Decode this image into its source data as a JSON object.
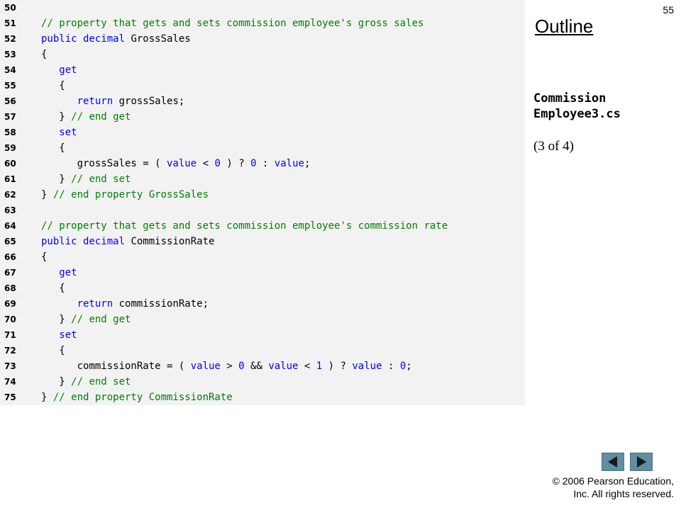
{
  "slide_number": "55",
  "outline": {
    "title": "Outline",
    "filename_line1": "Commission",
    "filename_line2": "Employee3.cs",
    "part": "(3 of 4)"
  },
  "code_lines": [
    {
      "n": "50",
      "tokens": []
    },
    {
      "n": "51",
      "tokens": [
        {
          "t": "cm",
          "s": "// property that gets and sets commission employee's gross sales"
        }
      ]
    },
    {
      "n": "52",
      "tokens": [
        {
          "t": "kw",
          "s": "public decimal"
        },
        {
          "t": "pl",
          "s": " GrossSales"
        }
      ]
    },
    {
      "n": "53",
      "tokens": [
        {
          "t": "pl",
          "s": "{"
        }
      ]
    },
    {
      "n": "54",
      "tokens": [
        {
          "t": "pl",
          "s": "   "
        },
        {
          "t": "kw",
          "s": "get"
        }
      ]
    },
    {
      "n": "55",
      "tokens": [
        {
          "t": "pl",
          "s": "   {"
        }
      ]
    },
    {
      "n": "56",
      "tokens": [
        {
          "t": "pl",
          "s": "      "
        },
        {
          "t": "kw",
          "s": "return"
        },
        {
          "t": "pl",
          "s": " grossSales;"
        }
      ]
    },
    {
      "n": "57",
      "tokens": [
        {
          "t": "pl",
          "s": "   } "
        },
        {
          "t": "cm",
          "s": "// end get"
        }
      ]
    },
    {
      "n": "58",
      "tokens": [
        {
          "t": "pl",
          "s": "   "
        },
        {
          "t": "kw",
          "s": "set"
        }
      ]
    },
    {
      "n": "59",
      "tokens": [
        {
          "t": "pl",
          "s": "   {"
        }
      ]
    },
    {
      "n": "60",
      "tokens": [
        {
          "t": "pl",
          "s": "      grossSales = ( "
        },
        {
          "t": "kw",
          "s": "value"
        },
        {
          "t": "pl",
          "s": " < "
        },
        {
          "t": "kw",
          "s": "0"
        },
        {
          "t": "pl",
          "s": " ) ? "
        },
        {
          "t": "kw",
          "s": "0"
        },
        {
          "t": "pl",
          "s": " : "
        },
        {
          "t": "kw",
          "s": "value"
        },
        {
          "t": "pl",
          "s": ";"
        }
      ]
    },
    {
      "n": "61",
      "tokens": [
        {
          "t": "pl",
          "s": "   } "
        },
        {
          "t": "cm",
          "s": "// end set"
        }
      ]
    },
    {
      "n": "62",
      "tokens": [
        {
          "t": "pl",
          "s": "} "
        },
        {
          "t": "cm",
          "s": "// end property GrossSales"
        }
      ]
    },
    {
      "n": "63",
      "tokens": []
    },
    {
      "n": "64",
      "tokens": [
        {
          "t": "cm",
          "s": "// property that gets and sets commission employee's commission rate"
        }
      ]
    },
    {
      "n": "65",
      "tokens": [
        {
          "t": "kw",
          "s": "public decimal"
        },
        {
          "t": "pl",
          "s": " CommissionRate"
        }
      ]
    },
    {
      "n": "66",
      "tokens": [
        {
          "t": "pl",
          "s": "{"
        }
      ]
    },
    {
      "n": "67",
      "tokens": [
        {
          "t": "pl",
          "s": "   "
        },
        {
          "t": "kw",
          "s": "get"
        }
      ]
    },
    {
      "n": "68",
      "tokens": [
        {
          "t": "pl",
          "s": "   {"
        }
      ]
    },
    {
      "n": "69",
      "tokens": [
        {
          "t": "pl",
          "s": "      "
        },
        {
          "t": "kw",
          "s": "return"
        },
        {
          "t": "pl",
          "s": " commissionRate;"
        }
      ]
    },
    {
      "n": "70",
      "tokens": [
        {
          "t": "pl",
          "s": "   } "
        },
        {
          "t": "cm",
          "s": "// end get"
        }
      ]
    },
    {
      "n": "71",
      "tokens": [
        {
          "t": "pl",
          "s": "   "
        },
        {
          "t": "kw",
          "s": "set"
        }
      ]
    },
    {
      "n": "72",
      "tokens": [
        {
          "t": "pl",
          "s": "   {"
        }
      ]
    },
    {
      "n": "73",
      "tokens": [
        {
          "t": "pl",
          "s": "      commissionRate = ( "
        },
        {
          "t": "kw",
          "s": "value"
        },
        {
          "t": "pl",
          "s": " > "
        },
        {
          "t": "kw",
          "s": "0"
        },
        {
          "t": "pl",
          "s": " && "
        },
        {
          "t": "kw",
          "s": "value"
        },
        {
          "t": "pl",
          "s": " < "
        },
        {
          "t": "kw",
          "s": "1"
        },
        {
          "t": "pl",
          "s": " ) ? "
        },
        {
          "t": "kw",
          "s": "value"
        },
        {
          "t": "pl",
          "s": " : "
        },
        {
          "t": "kw",
          "s": "0"
        },
        {
          "t": "pl",
          "s": ";"
        }
      ]
    },
    {
      "n": "74",
      "tokens": [
        {
          "t": "pl",
          "s": "   } "
        },
        {
          "t": "cm",
          "s": "// end set"
        }
      ]
    },
    {
      "n": "75",
      "tokens": [
        {
          "t": "pl",
          "s": "} "
        },
        {
          "t": "cm",
          "s": "// end property CommissionRate"
        }
      ]
    }
  ],
  "nav": {
    "prev_icon": "triangle-left-icon",
    "next_icon": "triangle-right-icon",
    "button_color": "#5f8fa0"
  },
  "copyright": {
    "line1": "© 2006 Pearson Education,",
    "line2": "Inc.  All rights reserved."
  },
  "colors": {
    "keyword": "#0000ff",
    "comment": "#008000",
    "code_background": "#f2f2f2"
  }
}
